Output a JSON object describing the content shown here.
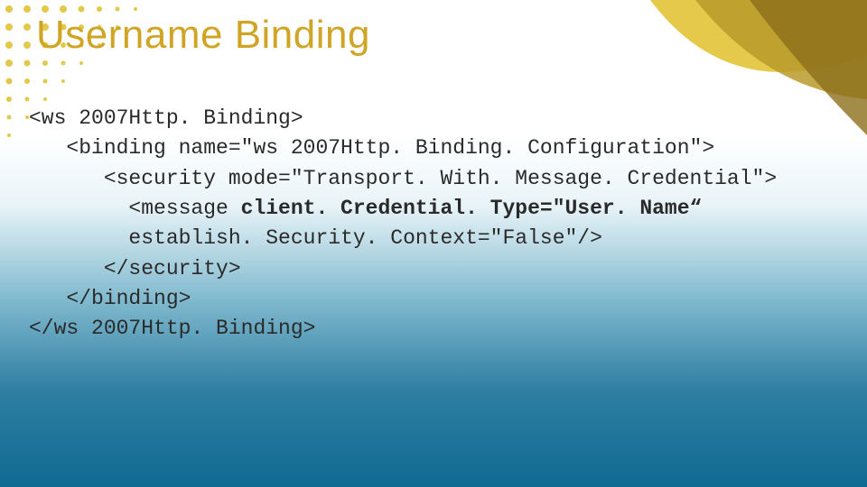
{
  "title": "Username Binding",
  "code": {
    "l1": "<ws 2007Http. Binding>",
    "l2": "   <binding name=\"ws 2007Http. Binding. Configuration\">",
    "l3": "      <security mode=\"Transport. With. Message. Credential\">",
    "l4a": "        <message ",
    "l4b": "client. Credential. Type=\"User. Name“",
    "l5": "        establish. Security. Context=\"False\"/>",
    "l6": "      </security>",
    "l7": "   </binding>",
    "l8": "</ws 2007Http. Binding>"
  }
}
